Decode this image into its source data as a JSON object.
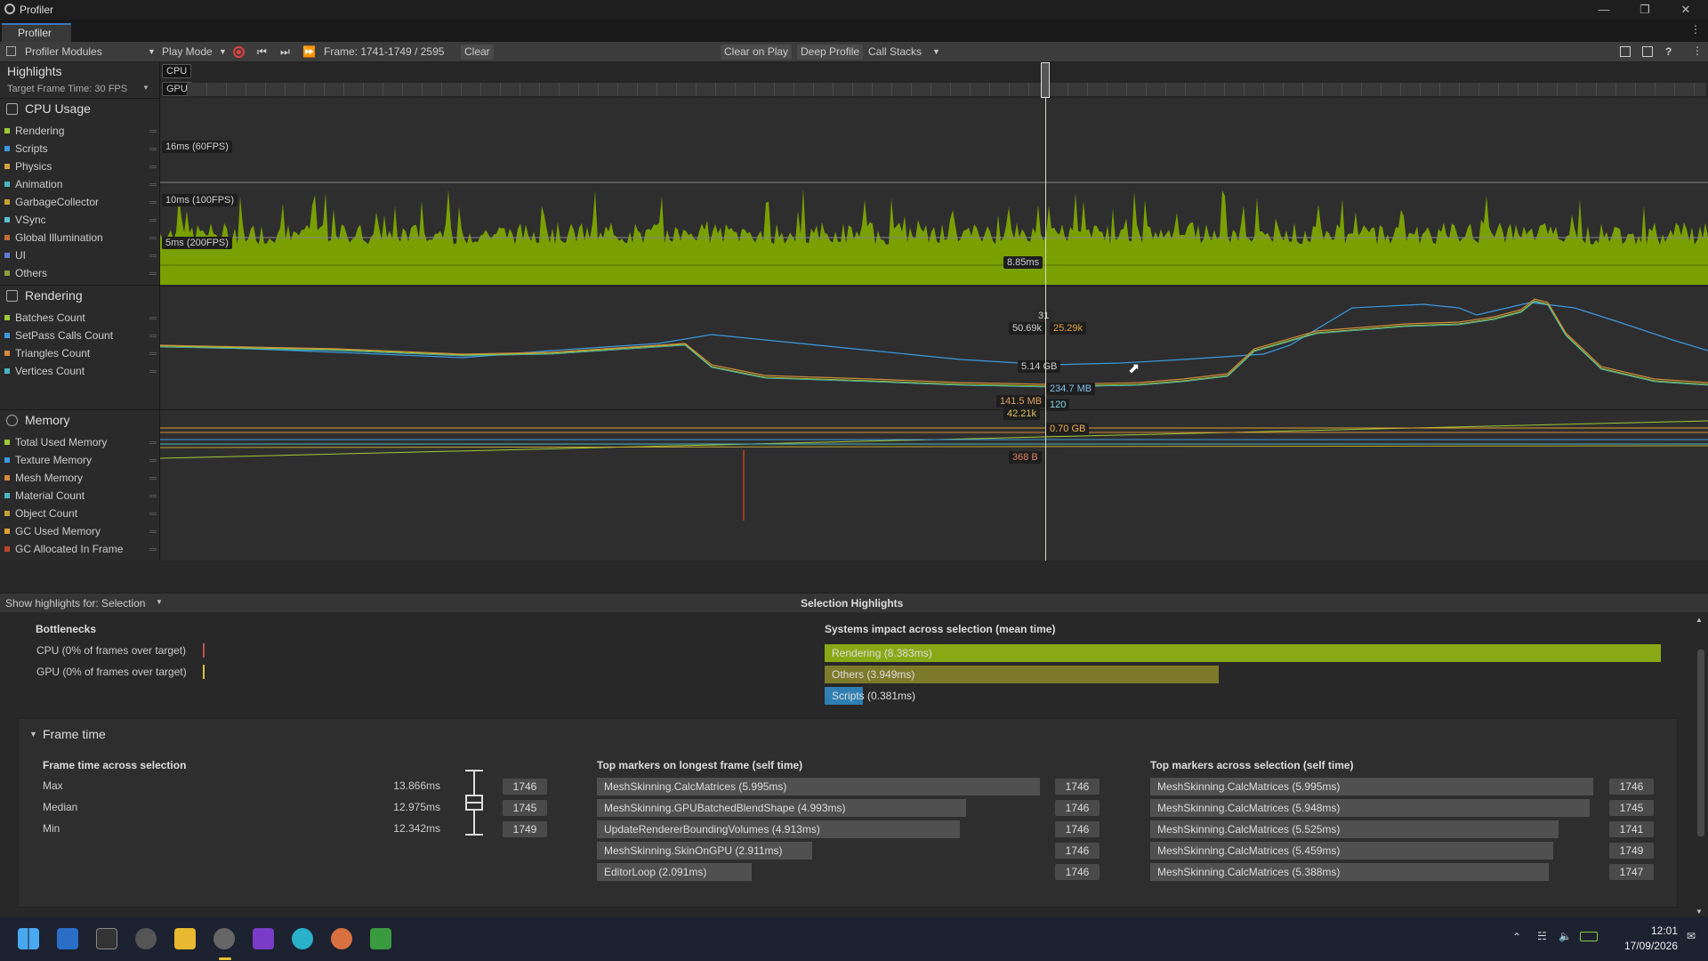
{
  "window": {
    "title": "Profiler",
    "tab": "Profiler"
  },
  "toolbar": {
    "modules": "Profiler Modules",
    "play_mode": "Play Mode",
    "frame": "Frame: 1741-1749 / 2595",
    "clear": "Clear",
    "clear_on_play": "Clear on Play",
    "deep_profile": "Deep Profile",
    "call_stacks": "Call Stacks"
  },
  "highlights": {
    "title": "Highlights",
    "target": "Target Frame Time: 30 FPS",
    "cpu": "CPU",
    "gpu": "GPU"
  },
  "cpu_usage": {
    "title": "CPU Usage",
    "items": [
      {
        "label": "Rendering",
        "color": "#a1c934"
      },
      {
        "label": "Scripts",
        "color": "#3a9be0"
      },
      {
        "label": "Physics",
        "color": "#d2a33b"
      },
      {
        "label": "Animation",
        "color": "#44b8c4"
      },
      {
        "label": "GarbageCollector",
        "color": "#c4a431"
      },
      {
        "label": "VSync",
        "color": "#5ec0d6"
      },
      {
        "label": "Global Illumination",
        "color": "#c46a36"
      },
      {
        "label": "UI",
        "color": "#5e7bd6"
      },
      {
        "label": "Others",
        "color": "#8a9e3b"
      }
    ],
    "thresholds": [
      "16ms (60FPS)",
      "10ms (100FPS)",
      "5ms (200FPS)"
    ],
    "selected_value": "8.85ms"
  },
  "rendering": {
    "title": "Rendering",
    "items": [
      {
        "label": "Batches Count",
        "color": "#a1c934"
      },
      {
        "label": "SetPass Calls Count",
        "color": "#3a9be0"
      },
      {
        "label": "Triangles Count",
        "color": "#d28a3b"
      },
      {
        "label": "Vertices Count",
        "color": "#44b8c4"
      }
    ],
    "values": [
      "31",
      "50.69k",
      "25.29k"
    ]
  },
  "memory": {
    "title": "Memory",
    "items": [
      {
        "label": "Total Used Memory",
        "color": "#a1c934"
      },
      {
        "label": "Texture Memory",
        "color": "#3a9be0"
      },
      {
        "label": "Mesh Memory",
        "color": "#d28a3b"
      },
      {
        "label": "Material Count",
        "color": "#44b8c4"
      },
      {
        "label": "Object Count",
        "color": "#c4a431"
      },
      {
        "label": "GC Used Memory",
        "color": "#e0a030"
      },
      {
        "label": "GC Allocated In Frame",
        "color": "#c0442a"
      }
    ],
    "values": [
      "5.14 GB",
      "234.7 MB",
      "141.5 MB",
      "120",
      "42.21k",
      "0.70 GB",
      "368 B"
    ]
  },
  "selection": {
    "show_for": "Show highlights for: Selection",
    "title": "Selection Highlights",
    "bottlenecks": "Bottlenecks",
    "cpu_line": "CPU (0% of frames over target)",
    "gpu_line": "GPU (0% of frames over target)",
    "systems_title": "Systems impact across selection (mean time)",
    "systems": [
      {
        "label": "Rendering (8.383ms)",
        "value_ms": 8.383,
        "color": "#8aa815"
      },
      {
        "label": "Others (3.949ms)",
        "value_ms": 3.949,
        "color": "#7d7a2a"
      },
      {
        "label": "Scripts (0.381ms)",
        "value_ms": 0.381,
        "color": "#2f7fb3"
      }
    ]
  },
  "frame_time": {
    "title": "Frame time",
    "across": "Frame time across selection",
    "rows": [
      {
        "name": "Max",
        "ms": "13.866ms",
        "frame": "1746"
      },
      {
        "name": "Median",
        "ms": "12.975ms",
        "frame": "1745"
      },
      {
        "name": "Min",
        "ms": "12.342ms",
        "frame": "1749"
      }
    ],
    "longest_title": "Top markers on longest frame (self time)",
    "longest": [
      {
        "label": "MeshSkinning.CalcMatrices (5.995ms)",
        "frame": "1746",
        "ms": 5.995
      },
      {
        "label": "MeshSkinning.GPUBatchedBlendShape (4.993ms)",
        "frame": "1746",
        "ms": 4.993
      },
      {
        "label": "UpdateRendererBoundingVolumes (4.913ms)",
        "frame": "1746",
        "ms": 4.913
      },
      {
        "label": "MeshSkinning.SkinOnGPU (2.911ms)",
        "frame": "1746",
        "ms": 2.911
      },
      {
        "label": "EditorLoop (2.091ms)",
        "frame": "1746",
        "ms": 2.091
      }
    ],
    "across_title": "Top markers across selection (self time)",
    "across_list": [
      {
        "label": "MeshSkinning.CalcMatrices (5.995ms)",
        "frame": "1746",
        "ms": 5.995
      },
      {
        "label": "MeshSkinning.CalcMatrices (5.948ms)",
        "frame": "1745",
        "ms": 5.948
      },
      {
        "label": "MeshSkinning.CalcMatrices (5.525ms)",
        "frame": "1741",
        "ms": 5.525
      },
      {
        "label": "MeshSkinning.CalcMatrices (5.459ms)",
        "frame": "1749",
        "ms": 5.459
      },
      {
        "label": "MeshSkinning.CalcMatrices (5.388ms)",
        "frame": "1747",
        "ms": 5.388
      }
    ]
  },
  "taskbar": {
    "time": "12:01",
    "date": "17/09/2026"
  }
}
